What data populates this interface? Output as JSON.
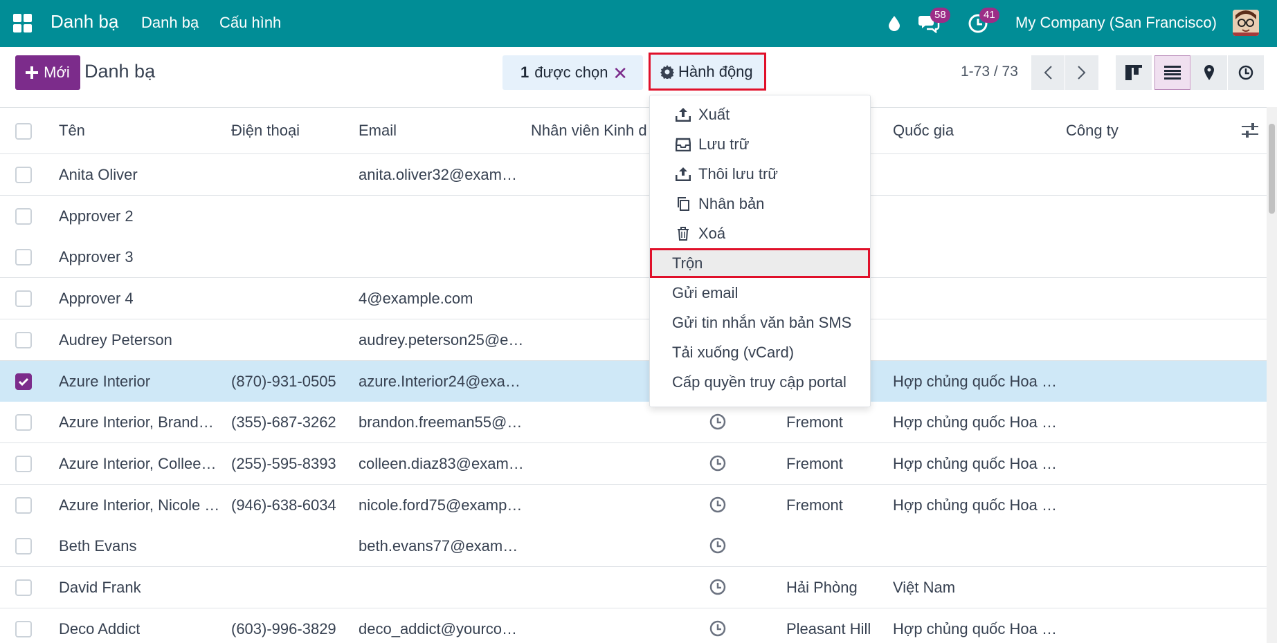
{
  "navbar": {
    "brand": "Danh bạ",
    "menu": [
      "Danh bạ",
      "Cấu hình"
    ],
    "messages_count": "58",
    "activities_count": "41",
    "company": "My Company (San Francisco)"
  },
  "control": {
    "new_label": "Mới",
    "title": "Danh bạ",
    "selected_count": "1",
    "selected_label": "được chọn",
    "action_label": "Hành động",
    "pager": "1-73 / 73"
  },
  "columns": [
    "Tên",
    "Điện thoại",
    "Email",
    "Nhân viên Kinh d",
    "Quốc gia",
    "Công ty"
  ],
  "rows": [
    {
      "name": "Anita Oliver",
      "phone": "",
      "email": "anita.oliver32@exam…",
      "activity": false,
      "city": "",
      "country": "",
      "checked": false
    },
    {
      "name": "Approver 2",
      "phone": "",
      "email": "",
      "activity": false,
      "city": "",
      "country": "",
      "checked": false
    },
    {
      "name": "Approver 3",
      "phone": "",
      "email": "",
      "activity": false,
      "city": "",
      "country": "",
      "checked": false
    },
    {
      "name": "Approver 4",
      "phone": "",
      "email": "4@example.com",
      "activity": false,
      "city": "",
      "country": "",
      "checked": false
    },
    {
      "name": "Audrey Peterson",
      "phone": "",
      "email": "audrey.peterson25@e…",
      "activity": false,
      "city": "",
      "country": "",
      "checked": false
    },
    {
      "name": "Azure Interior",
      "phone": "(870)-931-0505",
      "email": "azure.Interior24@exa…",
      "activity": false,
      "city": "",
      "country": "Hợp chủng quốc Hoa …",
      "checked": true
    },
    {
      "name": "Azure Interior, Brando…",
      "phone": "(355)-687-3262",
      "email": "brandon.freeman55@…",
      "activity": true,
      "city": "Fremont",
      "country": "Hợp chủng quốc Hoa …",
      "checked": false
    },
    {
      "name": "Azure Interior, Colleen…",
      "phone": "(255)-595-8393",
      "email": "colleen.diaz83@exam…",
      "activity": true,
      "city": "Fremont",
      "country": "Hợp chủng quốc Hoa …",
      "checked": false
    },
    {
      "name": "Azure Interior, Nicole …",
      "phone": "(946)-638-6034",
      "email": "nicole.ford75@examp…",
      "activity": true,
      "city": "Fremont",
      "country": "Hợp chủng quốc Hoa …",
      "checked": false
    },
    {
      "name": "Beth Evans",
      "phone": "",
      "email": "beth.evans77@exam…",
      "activity": true,
      "city": "",
      "country": "",
      "checked": false
    },
    {
      "name": "David Frank",
      "phone": "",
      "email": "",
      "activity": true,
      "city": "Hải Phòng",
      "country": "Việt Nam",
      "checked": false
    },
    {
      "name": "Deco Addict",
      "phone": "(603)-996-3829",
      "email": "deco_addict@yourco…",
      "activity": true,
      "city": "Pleasant Hill",
      "country": "Hợp chủng quốc Hoa …",
      "checked": false
    }
  ],
  "dropdown": {
    "items": [
      {
        "label": "Xuất",
        "icon": "upload-icon"
      },
      {
        "label": "Lưu trữ",
        "icon": "archive-icon"
      },
      {
        "label": "Thôi lưu trữ",
        "icon": "unarchive-icon"
      },
      {
        "label": "Nhân bản",
        "icon": "duplicate-icon"
      },
      {
        "label": "Xoá",
        "icon": "trash-icon"
      },
      {
        "label": "Trộn",
        "icon": ""
      },
      {
        "label": "Gửi email",
        "icon": ""
      },
      {
        "label": "Gửi tin nhắn văn bản SMS",
        "icon": ""
      },
      {
        "label": "Tải xuống (vCard)",
        "icon": ""
      },
      {
        "label": "Cấp quyền truy cập portal",
        "icon": ""
      }
    ]
  },
  "colors": {
    "navbar": "#018d96",
    "primary": "#7c2c8b",
    "selected_row": "#cfe8f7",
    "highlight_outline": "#e0102a"
  }
}
